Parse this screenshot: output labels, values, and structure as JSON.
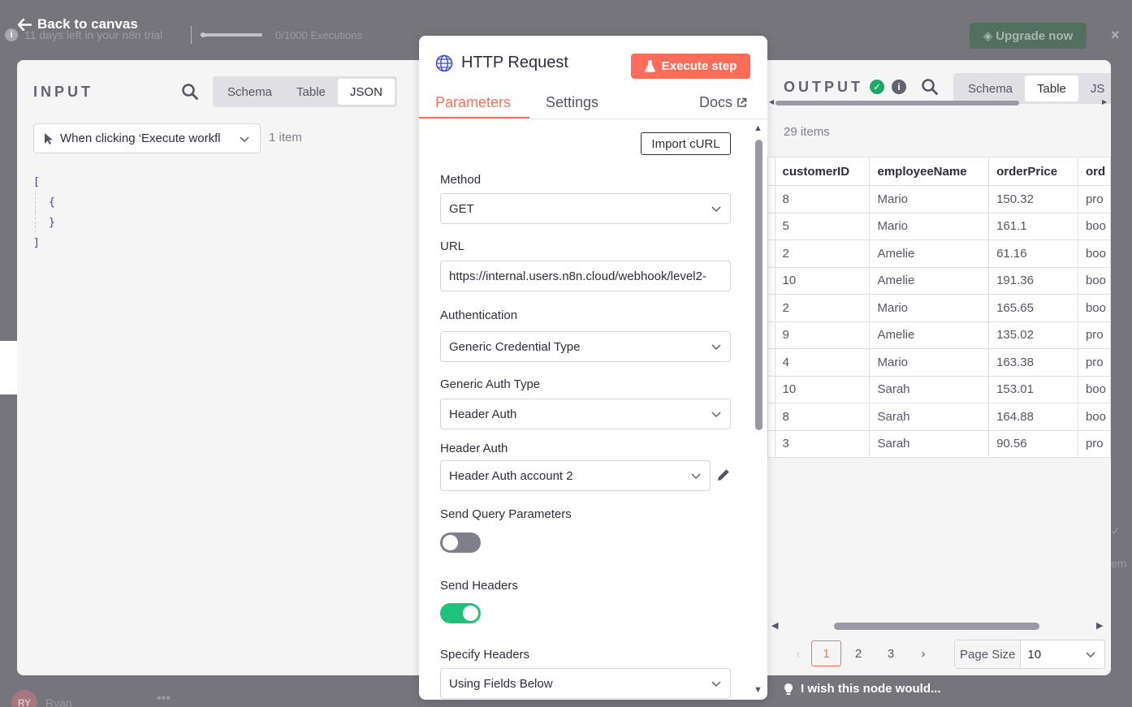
{
  "background": {
    "trial_text": "11 days left in your n8n trial",
    "executions_text": "0/1000 Executions",
    "upgrade_label": "Upgrade now",
    "close_label": "×",
    "user_initials": "RY",
    "user_name": "Ryan",
    "more_label": "•••",
    "side_em": "em"
  },
  "back_label": "Back to canvas",
  "input": {
    "title": "INPUT",
    "tabs": [
      "Schema",
      "Table",
      "JSON"
    ],
    "active_tab": "JSON",
    "trigger_label": "When clicking ‘Execute workfl",
    "item_count": "1 item",
    "json_lines": [
      "[",
      "{",
      "}",
      "]"
    ]
  },
  "node": {
    "title": "HTTP Request",
    "execute_label": "Execute step",
    "tabs": {
      "parameters": "Parameters",
      "settings": "Settings",
      "docs": "Docs"
    },
    "import_curl": "Import cURL",
    "fields": {
      "method_label": "Method",
      "method_value": "GET",
      "url_label": "URL",
      "url_value": "https://internal.users.n8n.cloud/webhook/level2-",
      "auth_label": "Authentication",
      "auth_value": "Generic Credential Type",
      "generic_auth_label": "Generic Auth Type",
      "generic_auth_value": "Header Auth",
      "header_auth_label": "Header Auth",
      "header_auth_value": "Header Auth account 2",
      "send_query_label": "Send Query Parameters",
      "send_query_on": false,
      "send_headers_label": "Send Headers",
      "send_headers_on": true,
      "specify_headers_label": "Specify Headers",
      "specify_headers_value": "Using Fields Below"
    }
  },
  "output": {
    "title": "OUTPUT",
    "tabs": [
      "Schema",
      "Table",
      "JS"
    ],
    "active_tab": "Table",
    "items_count": "29 items",
    "columns": [
      "customerID",
      "employeeName",
      "orderPrice",
      "ord"
    ],
    "rows": [
      [
        "8",
        "Mario",
        "150.32",
        "pro"
      ],
      [
        "5",
        "Mario",
        "161.1",
        "boo"
      ],
      [
        "2",
        "Amelie",
        "61.16",
        "boo"
      ],
      [
        "10",
        "Amelie",
        "191.36",
        "boo"
      ],
      [
        "2",
        "Mario",
        "165.65",
        "boo"
      ],
      [
        "9",
        "Amelie",
        "135.02",
        "pro"
      ],
      [
        "4",
        "Mario",
        "163.38",
        "pro"
      ],
      [
        "10",
        "Sarah",
        "153.01",
        "boo"
      ],
      [
        "8",
        "Sarah",
        "164.88",
        "boo"
      ],
      [
        "3",
        "Sarah",
        "90.56",
        "pro"
      ]
    ],
    "pages": [
      "1",
      "2",
      "3"
    ],
    "active_page": "1",
    "page_size_label": "Page Size",
    "page_size_value": "10"
  },
  "wish_text": "I wish this node would...",
  "colors": {
    "accent": "#ff6d5a",
    "success": "#1ec27a",
    "upgrade": "#51705f"
  }
}
